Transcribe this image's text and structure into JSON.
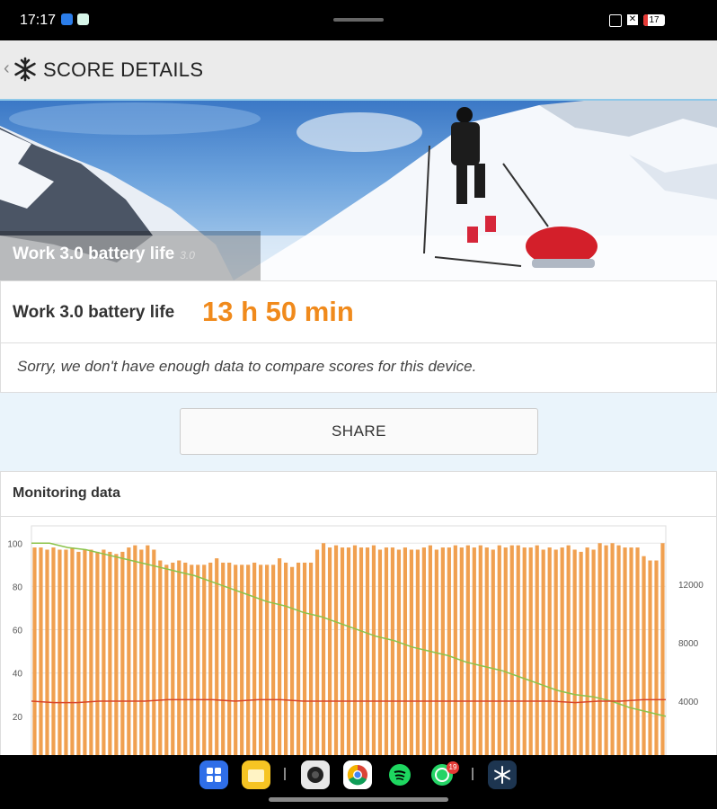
{
  "status_bar": {
    "time": "17:17",
    "battery": "17"
  },
  "header": {
    "back_icon": "chevron-left-icon",
    "logo_icon": "snowflake-icon",
    "title": "SCORE DETAILS"
  },
  "hero": {
    "label": "Work 3.0 battery life",
    "version": "3.0"
  },
  "result": {
    "name": "Work 3.0 battery life",
    "score": "13 h 50 min",
    "message": "Sorry, we don't have enough data to compare scores for this device."
  },
  "share_label": "SHARE",
  "monitoring": {
    "title": "Monitoring data"
  },
  "chart_data": {
    "type": "bar",
    "title": "",
    "left_axis": {
      "ylim": [
        0,
        108
      ],
      "ticks": [
        20,
        40,
        60,
        80,
        100
      ]
    },
    "right_axis": {
      "ylim": [
        0,
        16000
      ],
      "ticks": [
        4000,
        8000,
        12000
      ]
    },
    "grid": true,
    "series": [
      {
        "name": "",
        "type": "bar",
        "color": "#f0a050",
        "axis": "left",
        "values": [
          98,
          98,
          97,
          98,
          97,
          97,
          98,
          96,
          97,
          97,
          96,
          97,
          96,
          95,
          96,
          98,
          99,
          97,
          99,
          97,
          92,
          90,
          91,
          92,
          91,
          90,
          90,
          90,
          91,
          93,
          91,
          91,
          90,
          90,
          90,
          91,
          90,
          90,
          90,
          93,
          91,
          89,
          91,
          91,
          91,
          97,
          100,
          98,
          99,
          98,
          98,
          99,
          98,
          98,
          99,
          97,
          98,
          98,
          97,
          98,
          97,
          97,
          98,
          99,
          97,
          98,
          98,
          99,
          98,
          99,
          98,
          99,
          98,
          97,
          99,
          98,
          99,
          99,
          98,
          98,
          99,
          97,
          98,
          97,
          98,
          99,
          97,
          96,
          98,
          97,
          100,
          99,
          100,
          99,
          98,
          98,
          98,
          94,
          92,
          92,
          100
        ]
      },
      {
        "name": "",
        "type": "line",
        "color": "#8bc34a",
        "axis": "left",
        "values": [
          100,
          100,
          98,
          97,
          95,
          93,
          91,
          89,
          87,
          85,
          82,
          79,
          76,
          73,
          71,
          68,
          66,
          63,
          60,
          57,
          55,
          52,
          50,
          48,
          45,
          43,
          41,
          38,
          35,
          32,
          30,
          29,
          27,
          24,
          22,
          20
        ]
      },
      {
        "name": "",
        "type": "line",
        "color": "#d9462a",
        "axis": "right",
        "values": [
          4000,
          3900,
          3900,
          4000,
          4000,
          4000,
          4100,
          4100,
          4100,
          4000,
          4100,
          4100,
          4000,
          4000,
          4000,
          4000,
          4000,
          4000,
          4000,
          4000,
          4000,
          4000,
          4000,
          4000,
          3900,
          4000,
          4000,
          4100,
          4100
        ]
      }
    ]
  },
  "dock": {
    "icons": [
      "apps-icon",
      "files-icon",
      "camera-icon",
      "chrome-icon",
      "spotify-icon",
      "whatsapp-icon",
      "pcmark-icon"
    ],
    "whatsapp_badge": "19"
  },
  "colors": {
    "accent": "#f08a1c",
    "bar": "#f0a050",
    "battery_line": "#8bc34a",
    "temp_line": "#d9462a",
    "page_bg": "#eaf4fb"
  }
}
